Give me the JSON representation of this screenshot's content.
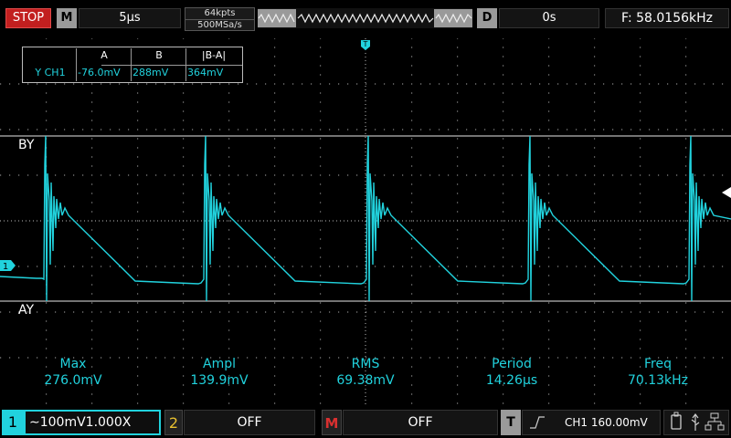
{
  "topbar": {
    "run_state": "STOP",
    "menu_key": "M",
    "timebase": "5µs",
    "memory_depth": "64kpts",
    "sample_rate": "500MSa/s",
    "delay_key": "D",
    "trigger_delay": "0s",
    "frequency": "F: 58.0156kHz"
  },
  "graticule": {
    "trigger_marker": "T",
    "channel_marker": "1"
  },
  "cursor_table": {
    "headers": [
      "A",
      "B",
      "|B-A|"
    ],
    "row_label": "Y CH1",
    "values": [
      "-76.0mV",
      "288mV",
      "364mV"
    ]
  },
  "cursors": {
    "b_label": "BY",
    "a_label": "AY"
  },
  "measurements": [
    {
      "name": "Max",
      "value": "276.0mV"
    },
    {
      "name": "Ampl",
      "value": "139.9mV"
    },
    {
      "name": "RMS",
      "value": "69.38mV"
    },
    {
      "name": "Period",
      "value": "14.26µs"
    },
    {
      "name": "Freq",
      "value": "70.13kHz"
    }
  ],
  "bottombar": {
    "ch1_number": "1",
    "ch1_setting": "∼100mV1.000X",
    "ch2_number": "2",
    "ch2_state": "OFF",
    "math_key": "M",
    "math_state": "OFF",
    "trigger_key": "T",
    "trigger_setting": "CH1 160.00mV"
  },
  "colors": {
    "trace": "#21d2dd",
    "stop": "#c21f1f",
    "ch2": "#e8c030",
    "math": "#d93030"
  },
  "icons": [
    "trigger-slope-rising-icon",
    "usb-icon",
    "usb-device-icon",
    "lan-icon"
  ]
}
